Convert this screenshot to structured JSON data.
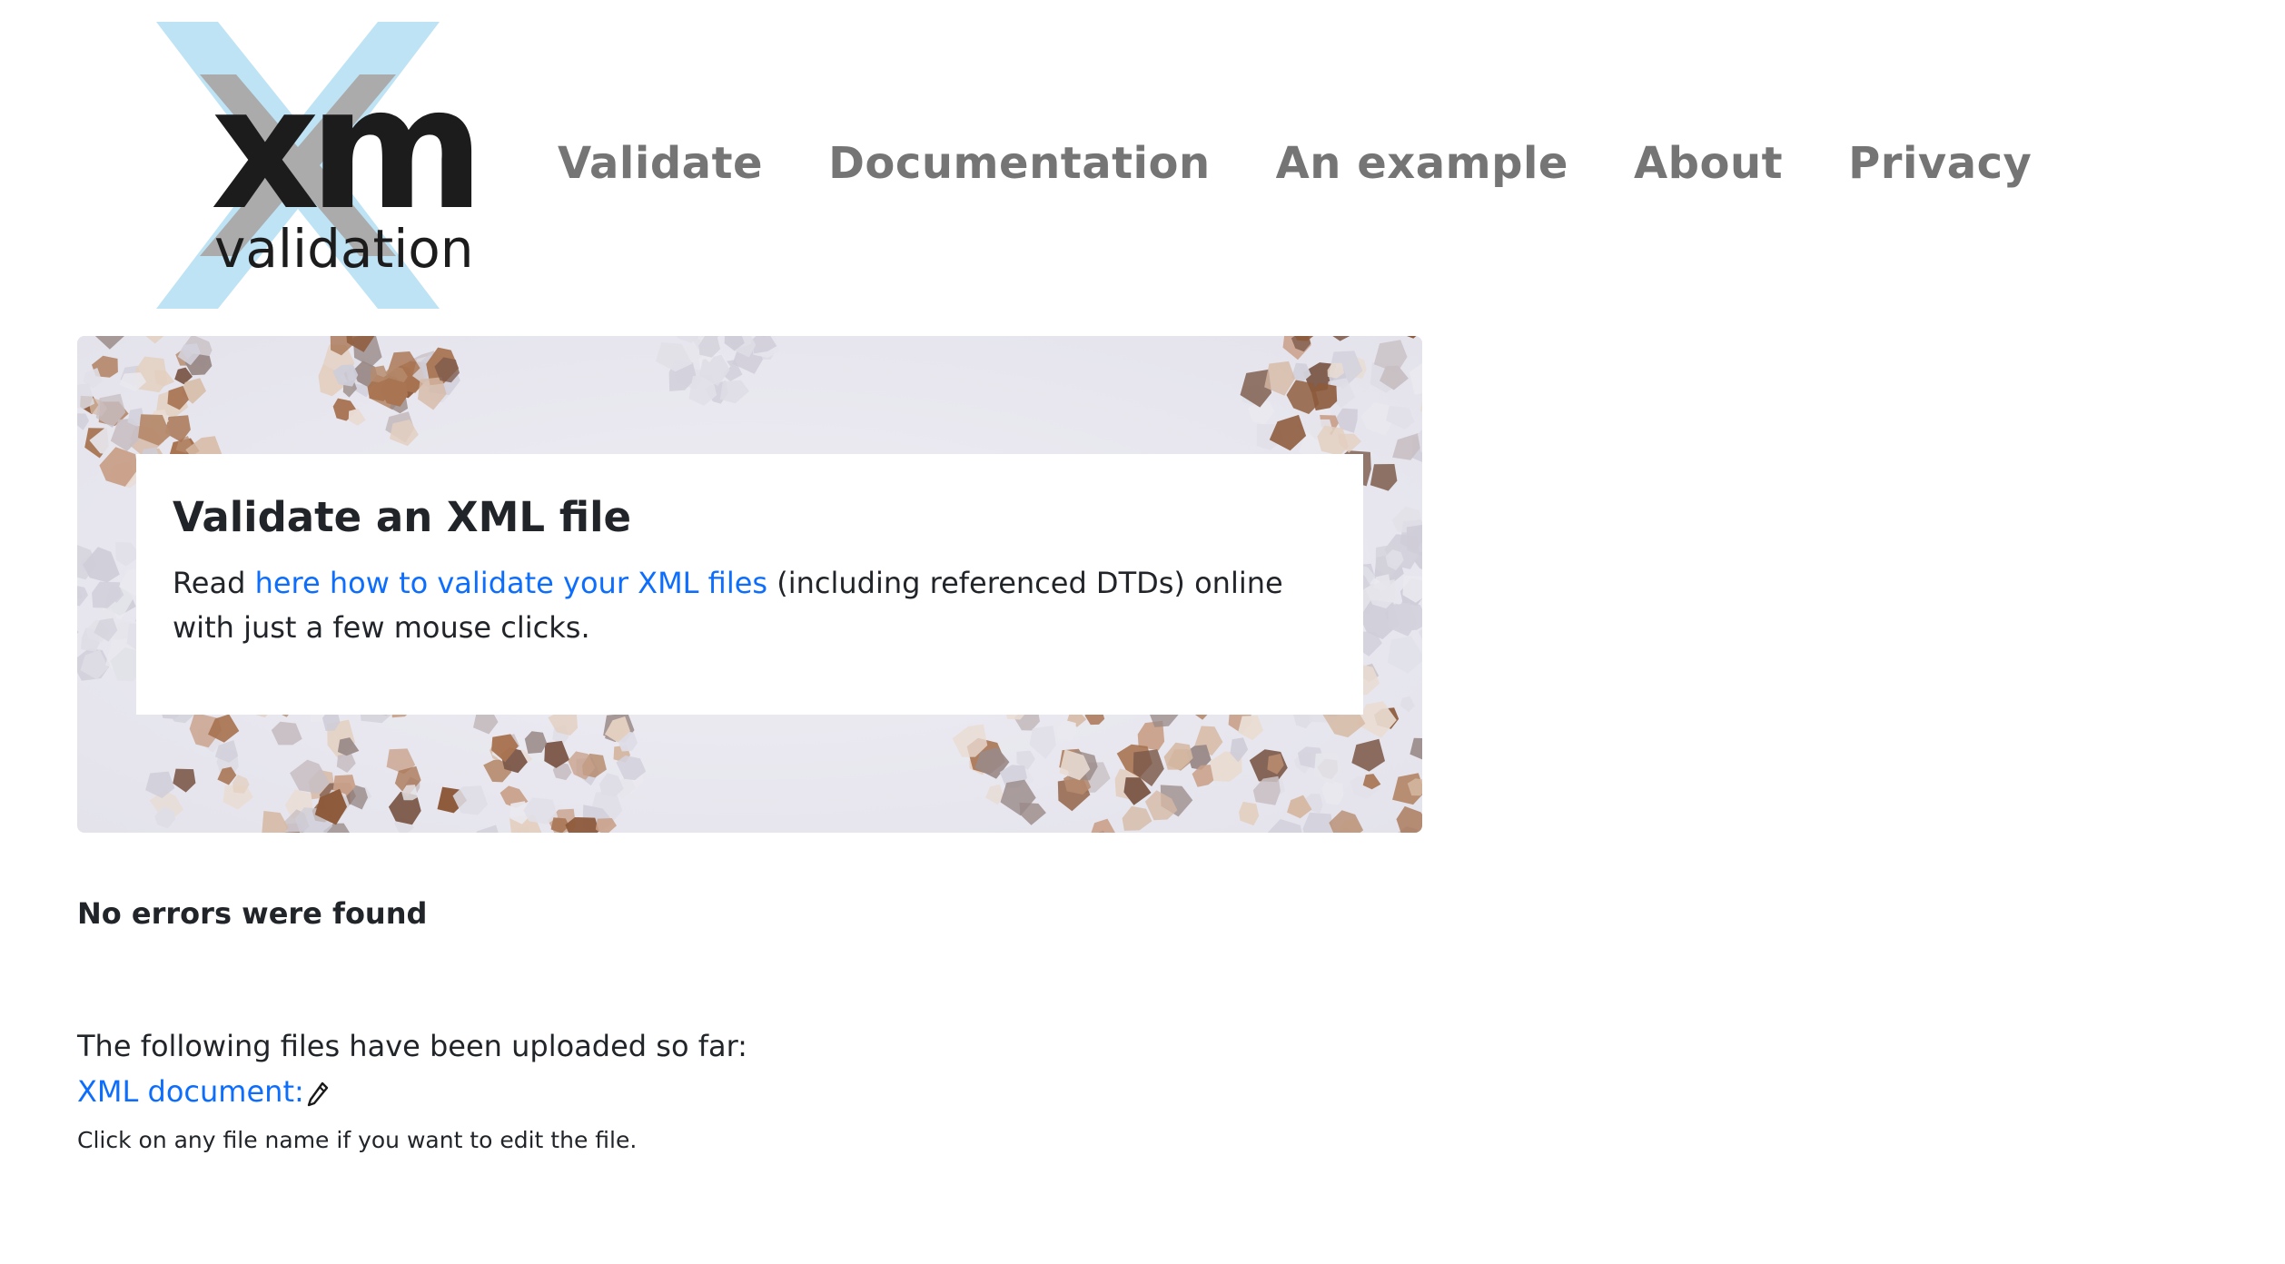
{
  "logo": {
    "word": "xml",
    "subtitle": "validation"
  },
  "nav": {
    "items": [
      {
        "label": "Validate"
      },
      {
        "label": "Documentation"
      },
      {
        "label": "An example"
      },
      {
        "label": "About"
      },
      {
        "label": "Privacy"
      }
    ]
  },
  "hero": {
    "title": "Validate an XML file",
    "text_before": "Read ",
    "link_text": "here how to validate your XML files",
    "text_after": " (including referenced DTDs) online with just a few mouse clicks."
  },
  "result": {
    "message": "No errors were found"
  },
  "uploads": {
    "intro": "The following files have been uploaded so far:",
    "file_label": "XML document:",
    "hint": "Click on any file name if you want to edit the file."
  },
  "colors": {
    "nav_text": "#757575",
    "link": "#0d6efd",
    "logo_x": "#bde3f5",
    "logo_x_inner": "#a9a9a9"
  },
  "icons": {
    "edit": "pencil-icon"
  }
}
